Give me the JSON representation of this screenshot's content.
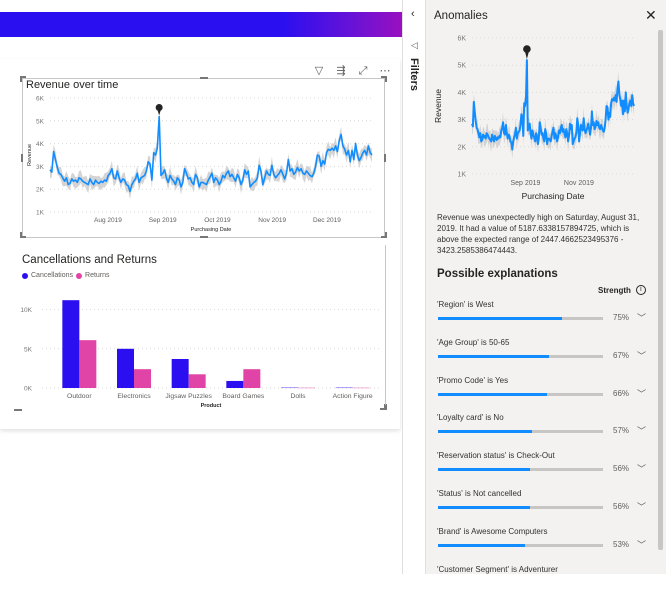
{
  "toolbar_icons": [
    "filter-icon",
    "drill-icon",
    "focus-mode-icon",
    "more-options-icon"
  ],
  "toolbar_glyphs": {
    "filter": "▽",
    "drill": "⇶",
    "focus": "⤢",
    "more": "⋯"
  },
  "filters_rail": {
    "label": "Filters",
    "collapse_glyph": "‹",
    "filter_glyph": "◁"
  },
  "revenue_chart": {
    "chart_data": {
      "type": "line",
      "title": "Revenue over time",
      "xlabel": "Purchasing Date",
      "ylabel": "Revenue",
      "yticks": [
        "1K",
        "2K",
        "3K",
        "4K",
        "5K",
        "6K"
      ],
      "ylim": [
        1000,
        6000
      ],
      "xticks": [
        "Aug 2019",
        "Sep 2019",
        "Oct 2019",
        "Nov 2019",
        "Dec 2019"
      ],
      "xtick_positions": [
        0.18,
        0.35,
        0.52,
        0.69,
        0.86
      ],
      "series": [
        {
          "name": "Revenue",
          "color": "#118dff",
          "values": [
            2850,
            2750,
            3650,
            3300,
            2950,
            2700,
            2650,
            2500,
            2350,
            2500,
            2200,
            2250,
            2450,
            2350,
            2400,
            2300,
            2500,
            2450,
            2350,
            2300,
            2250,
            2200,
            2450,
            2300,
            2200,
            2400,
            2300,
            2250,
            2350,
            2300,
            2400,
            2350,
            2600,
            2700,
            2900,
            2500,
            2450,
            2800,
            2500,
            2300,
            2450,
            2400,
            2200,
            2150,
            1900,
            2200,
            2350,
            2450,
            2700,
            2300,
            2500,
            2550,
            2600,
            2800,
            3200,
            3100,
            2400,
            3600,
            3500,
            3800,
            5188,
            2600,
            2700,
            2850,
            2500,
            2300,
            2600,
            2450,
            2350,
            2200,
            2500,
            2400,
            2100,
            2300,
            2900,
            2700,
            2450,
            2500,
            2300,
            2200,
            2650,
            2500,
            2100,
            2300,
            2300,
            2250,
            2200,
            2400,
            2550,
            2700,
            2300,
            2500,
            2400,
            2200,
            2350,
            2600,
            2500,
            2700,
            2800,
            2550,
            2650,
            2500,
            2350,
            2650,
            2500,
            2200,
            2400,
            2850,
            2650,
            2800,
            2100,
            2200,
            2300,
            2350,
            2500,
            3050,
            2800,
            2200,
            2500,
            2800,
            2650,
            2600,
            3050,
            2650,
            2500,
            2600,
            2700,
            2850,
            2650,
            2450,
            2700,
            3300,
            2800,
            2900,
            2650,
            2750,
            2950,
            2800,
            2900,
            2700,
            2650,
            2800,
            2700,
            2600,
            2550,
            2700,
            3000,
            3500,
            3450,
            3000,
            3250,
            3100,
            3600,
            3750,
            3700,
            3800,
            3700,
            3900,
            3650,
            4150,
            4400,
            3900,
            3750,
            3500,
            3700,
            3200,
            3700,
            3300,
            4000,
            3500,
            3250,
            3400,
            3600,
            3700,
            3500,
            3900,
            3600,
            3500
          ]
        }
      ],
      "anomaly_index": 60,
      "band_width": 420,
      "band_color": "#c8c8c8"
    }
  },
  "cancel_chart": {
    "chart_data": {
      "type": "bar",
      "title": "Cancellations and Returns",
      "xlabel": "Product",
      "ylabel": "",
      "categories": [
        "Outdoor",
        "Electronics",
        "Jigsaw Puzzles",
        "Board Games",
        "Dolls",
        "Action Figure"
      ],
      "series": [
        {
          "name": "Cancellations",
          "color": "#2b0ff0",
          "values": [
            11200,
            5000,
            3700,
            900,
            120,
            120
          ]
        },
        {
          "name": "Returns",
          "color": "#e044a7",
          "values": [
            6100,
            2400,
            1750,
            2400,
            80,
            80
          ]
        }
      ],
      "yticks": [
        "0K",
        "5K",
        "10K"
      ],
      "ylim": [
        0,
        12500
      ]
    }
  },
  "anomalies_pane": {
    "title": "Anomalies",
    "close_glyph": "✕",
    "mini_chart": {
      "chart_data": {
        "type": "line",
        "xlabel": "Purchasing Date",
        "ylabel": "Revenue",
        "yticks": [
          "1K",
          "2K",
          "3K",
          "4K",
          "5K",
          "6K"
        ],
        "ylim": [
          1000,
          6000
        ],
        "xticks": [
          "Sep 2019",
          "Nov 2019"
        ],
        "xtick_positions": [
          0.33,
          0.66
        ]
      }
    },
    "description": "Revenue was unexpectedly high on Saturday, August 31, 2019. It had a value of 5187.6338157894725, which is above the expected range of 2447.4662523495376 - 3423.2585386474443.",
    "explanations_title": "Possible explanations",
    "strength_label": "Strength",
    "info_glyph": "i",
    "chevron_glyph": "﹀",
    "explanations": [
      {
        "label": "'Region' is West",
        "value": 75,
        "pct": "75%"
      },
      {
        "label": "'Age Group' is 50-65",
        "value": 67,
        "pct": "67%"
      },
      {
        "label": "'Promo Code' is Yes",
        "value": 66,
        "pct": "66%"
      },
      {
        "label": "'Loyalty card' is No",
        "value": 57,
        "pct": "57%"
      },
      {
        "label": "'Reservation status' is Check-Out",
        "value": 56,
        "pct": "56%"
      },
      {
        "label": "'Status' is Not cancelled",
        "value": 56,
        "pct": "56%"
      },
      {
        "label": "'Brand' is Awesome Computers",
        "value": 53,
        "pct": "53%"
      },
      {
        "label": "'Customer Segment' is Adventurer",
        "value": null,
        "pct": ""
      }
    ]
  }
}
